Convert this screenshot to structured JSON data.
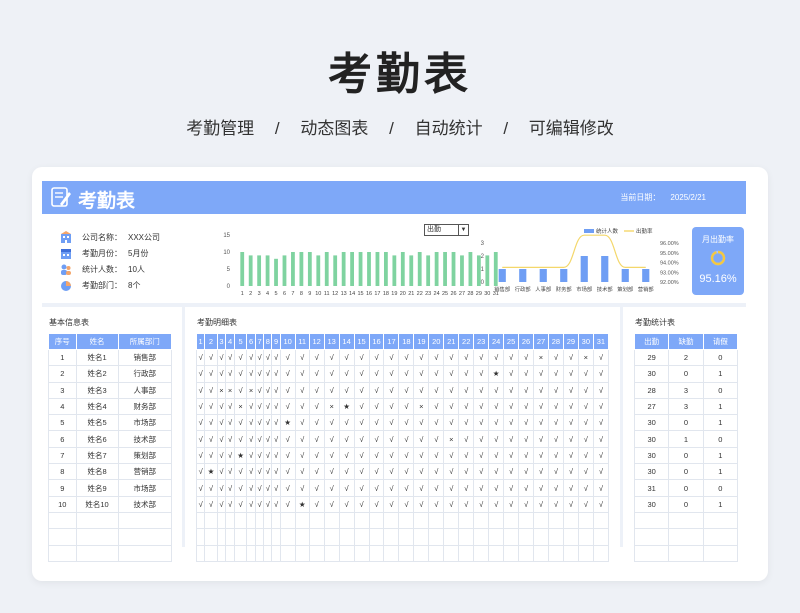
{
  "hero": {
    "title": "考勤表",
    "subs": [
      "考勤管理",
      "/",
      "动态图表",
      "/",
      "自动统计",
      "/",
      "可编辑修改"
    ]
  },
  "banner": {
    "title": "考勤表",
    "date_label": "当前日期：",
    "date_value": "2025/2/21"
  },
  "info": [
    {
      "icon": "building-icon",
      "key": "公司名称：",
      "value": "XXX公司"
    },
    {
      "icon": "calendar-icon",
      "key": "考勤月份：",
      "value": "5月份"
    },
    {
      "icon": "people-icon",
      "key": "统计人数：",
      "value": "10人"
    },
    {
      "icon": "pie-icon",
      "key": "考勤部门：",
      "value": "8个"
    }
  ],
  "dropdown": {
    "value": "出勤"
  },
  "rate": {
    "label": "月出勤率",
    "value": "95.16%",
    "level": 0.9516
  },
  "colors": {
    "accent": "#7ea8f8",
    "bar_green": "#7fd3a0",
    "bar_blue": "#6f9ef4",
    "line_yellow": "#f4d76a"
  },
  "chart_data": [
    {
      "type": "bar",
      "categories": [
        "1",
        "2",
        "3",
        "4",
        "5",
        "6",
        "7",
        "8",
        "9",
        "10",
        "11",
        "12",
        "13",
        "14",
        "15",
        "16",
        "17",
        "18",
        "19",
        "20",
        "21",
        "22",
        "23",
        "24",
        "25",
        "26",
        "27",
        "28",
        "29",
        "30",
        "31"
      ],
      "values": [
        10,
        9,
        9,
        9,
        8,
        9,
        10,
        10,
        10,
        9,
        10,
        9,
        10,
        10,
        10,
        10,
        10,
        10,
        9,
        10,
        9,
        10,
        9,
        10,
        10,
        10,
        9,
        10,
        9,
        9,
        10
      ],
      "yticks": [
        "0",
        "5",
        "10",
        "15"
      ],
      "ylim": [
        0,
        15
      ]
    },
    {
      "type": "bar",
      "categories": [
        "销售部",
        "行政部",
        "人事部",
        "财务部",
        "市场部",
        "技术部",
        "策划部",
        "营销部"
      ],
      "series": [
        {
          "name": "统计人数",
          "values": [
            1,
            1,
            1,
            1,
            2,
            2,
            1,
            1
          ]
        },
        {
          "name": "出勤率",
          "values": [
            93.5,
            93.5,
            93.5,
            93.5,
            96.8,
            96.8,
            93.5,
            93.5
          ]
        }
      ],
      "yticks_left": [
        "0",
        "1",
        "2",
        "3"
      ],
      "yticks_right": [
        "92.00%",
        "93.00%",
        "94.00%",
        "95.00%",
        "96.00%"
      ],
      "ylim": [
        0,
        3
      ],
      "ylim_right": [
        92,
        96
      ],
      "legend": "top-right"
    }
  ],
  "basic": {
    "title": "基本信息表",
    "headers": [
      "序号",
      "姓名",
      "所属部门"
    ],
    "rows": [
      [
        "1",
        "姓名1",
        "销售部"
      ],
      [
        "2",
        "姓名2",
        "行政部"
      ],
      [
        "3",
        "姓名3",
        "人事部"
      ],
      [
        "4",
        "姓名4",
        "财务部"
      ],
      [
        "5",
        "姓名5",
        "市场部"
      ],
      [
        "6",
        "姓名6",
        "技术部"
      ],
      [
        "7",
        "姓名7",
        "策划部"
      ],
      [
        "8",
        "姓名8",
        "营销部"
      ],
      [
        "9",
        "姓名9",
        "市场部"
      ],
      [
        "10",
        "姓名10",
        "技术部"
      ]
    ]
  },
  "detail": {
    "title": "考勤明细表",
    "days": [
      "1",
      "2",
      "3",
      "4",
      "5",
      "6",
      "7",
      "8",
      "9",
      "10",
      "11",
      "12",
      "13",
      "14",
      "15",
      "16",
      "17",
      "18",
      "19",
      "20",
      "21",
      "22",
      "23",
      "24",
      "25",
      "26",
      "27",
      "28",
      "29",
      "30",
      "31"
    ],
    "rows": [
      "√√√√√√√√√√√√√√√√√√√√√√√√√√×√√×√",
      "√√√√√√√√√√√√√√√√√√√√√√√★√√√√√√√",
      "√√××√×√√√√√√√√√√√√√√√√√√√√√√√√√",
      "√√√√×√√√√√√√×★√√√√×√√√√√√√√√√√√",
      "√√√√√√√√√★√√√√√√√√√√√√√√√√√√√√√",
      "√√√√√√√√√√√√√√√√√√√√×√√√√√√√√√√",
      "√√√√★√√√√√√√√√√√√√√√√√√√√√√√√√√",
      "√★√√√√√√√√√√√√√√√√√√√√√√√√√√√√√",
      "√√√√√√√√√√√√√√√√√√√√√√√√√√√√√√√",
      "√√√√√√√√√√★√√√√√√√√√√√√√√√√√√√√"
    ]
  },
  "stats": {
    "title": "考勤统计表",
    "headers": [
      "出勤",
      "缺勤",
      "请假"
    ],
    "rows": [
      [
        "29",
        "2",
        "0"
      ],
      [
        "30",
        "0",
        "1"
      ],
      [
        "28",
        "3",
        "0"
      ],
      [
        "27",
        "3",
        "1"
      ],
      [
        "30",
        "0",
        "1"
      ],
      [
        "30",
        "1",
        "0"
      ],
      [
        "30",
        "0",
        "1"
      ],
      [
        "30",
        "0",
        "1"
      ],
      [
        "31",
        "0",
        "0"
      ],
      [
        "30",
        "0",
        "1"
      ]
    ]
  }
}
